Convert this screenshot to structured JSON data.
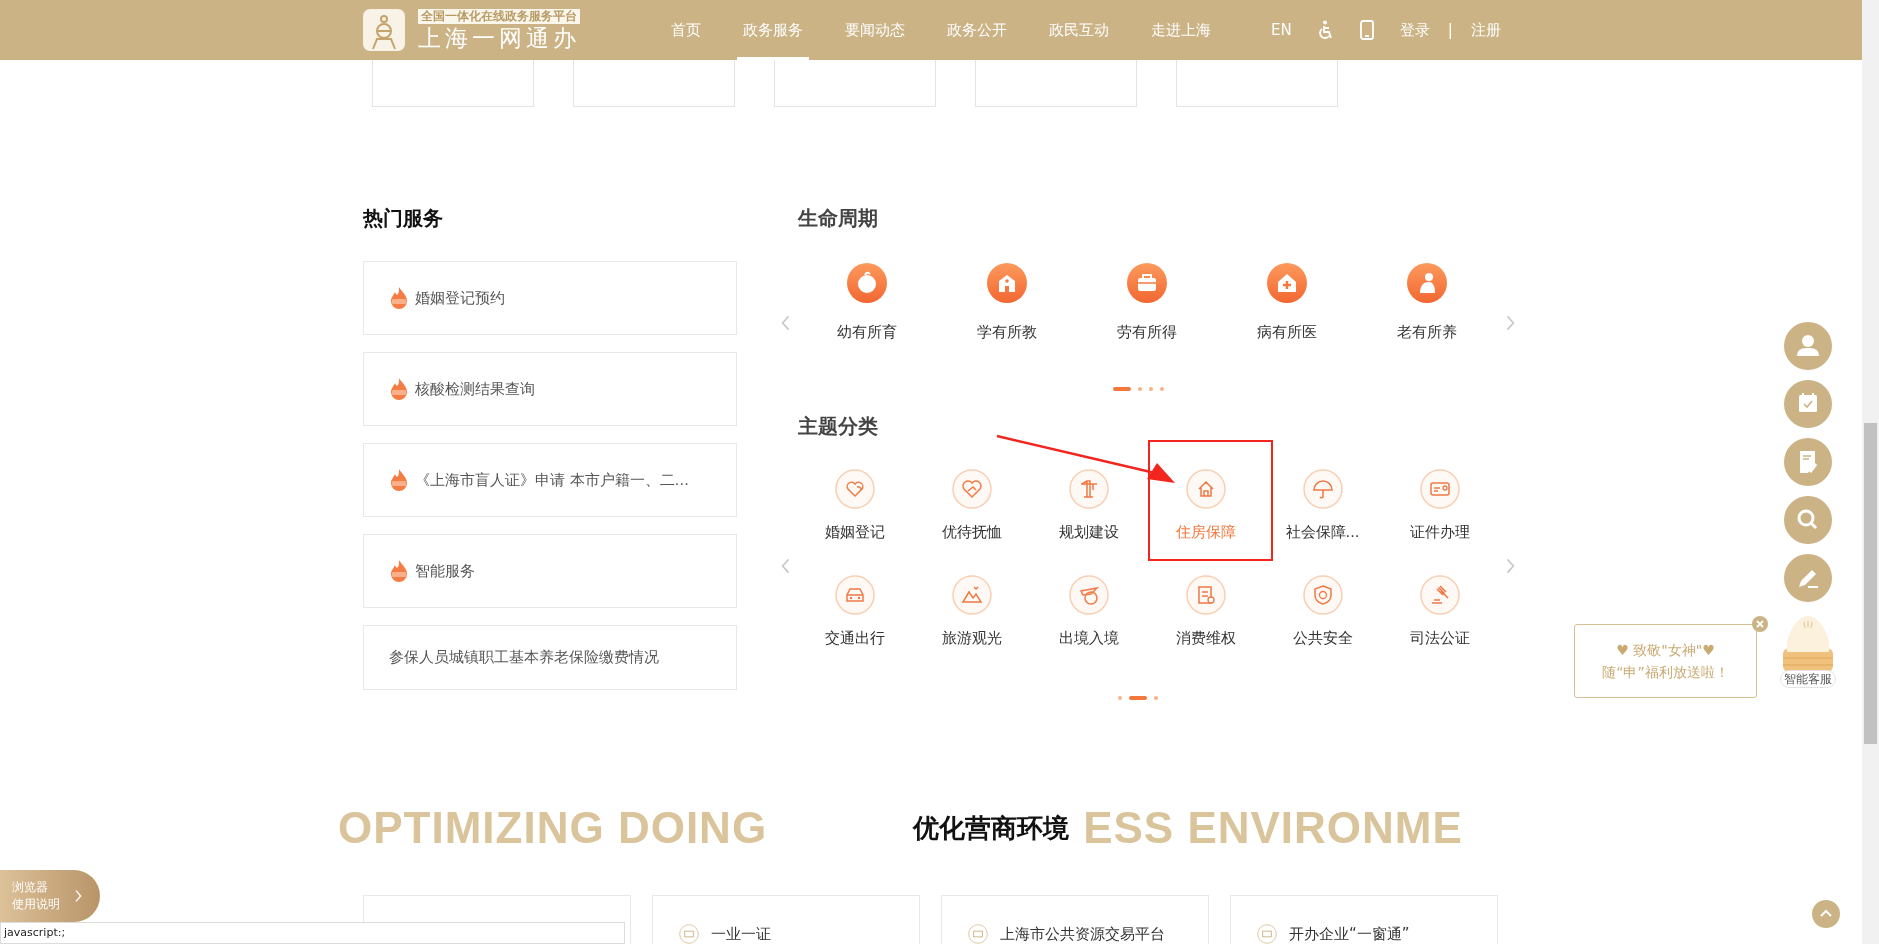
{
  "header": {
    "tagline": "全国一体化在线政务服务平台",
    "title": "上海一网通办",
    "nav": [
      {
        "label": "首页",
        "selected": false
      },
      {
        "label": "政务服务",
        "selected": true
      },
      {
        "label": "要闻动态",
        "selected": false
      },
      {
        "label": "政务公开",
        "selected": false
      },
      {
        "label": "政民互动",
        "selected": false
      },
      {
        "label": "走进上海",
        "selected": false
      }
    ],
    "lang": "EN",
    "login": "登录",
    "separator": "|",
    "register": "注册"
  },
  "hot_services": {
    "title": "热门服务",
    "items": [
      {
        "label": "婚姻登记预约",
        "hot": true
      },
      {
        "label": "核酸检测结果查询",
        "hot": true
      },
      {
        "label": "《上海市盲人证》申请 本市户籍一、二…",
        "hot": true
      },
      {
        "label": "智能服务",
        "hot": true
      },
      {
        "label": "参保人员城镇职工基本养老保险缴费情况",
        "hot": false
      }
    ]
  },
  "life_cycle": {
    "title": "生命周期",
    "items": [
      {
        "label": "幼有所育"
      },
      {
        "label": "学有所教"
      },
      {
        "label": "劳有所得"
      },
      {
        "label": "病有所医"
      },
      {
        "label": "老有所养"
      }
    ],
    "pages": [
      {
        "selected": true
      },
      {
        "selected": false
      },
      {
        "selected": false
      },
      {
        "selected": false
      }
    ]
  },
  "topics": {
    "title": "主题分类",
    "items": [
      {
        "label": "婚姻登记",
        "selected": false,
        "annotated": false
      },
      {
        "label": "优待抚恤",
        "selected": false,
        "annotated": false
      },
      {
        "label": "规划建设",
        "selected": false,
        "annotated": false
      },
      {
        "label": "住房保障",
        "selected": true,
        "annotated": true
      },
      {
        "label": "社会保障...",
        "selected": false,
        "annotated": false
      },
      {
        "label": "证件办理",
        "selected": false,
        "annotated": false
      },
      {
        "label": "交通出行",
        "selected": false,
        "annotated": false
      },
      {
        "label": "旅游观光",
        "selected": false,
        "annotated": false
      },
      {
        "label": "出境入境",
        "selected": false,
        "annotated": false
      },
      {
        "label": "消费维权",
        "selected": false,
        "annotated": false
      },
      {
        "label": "公共安全",
        "selected": false,
        "annotated": false
      },
      {
        "label": "司法公证",
        "selected": false,
        "annotated": false
      }
    ],
    "pages": [
      {
        "selected": false
      },
      {
        "selected": true
      },
      {
        "selected": false
      }
    ]
  },
  "promo_bubble": {
    "lines": [
      "♥ 致敬\"女神\"♥",
      "随“申”福利放送啦！"
    ]
  },
  "assistant": {
    "label": "智能客服"
  },
  "business": {
    "backdrop": [
      "OPTIMIZING DOING",
      "ESS ENVIRONME"
    ],
    "title": "优化营商环境",
    "cards": [
      {
        "covered": true
      },
      {
        "label": "一业一证"
      },
      {
        "label": "上海市公共资源交易平台"
      },
      {
        "label": "开办企业“一窗通”"
      }
    ]
  },
  "guide_tab": {
    "lines": [
      "浏览器",
      "使用说明"
    ]
  },
  "status_bar": "javascript:;"
}
